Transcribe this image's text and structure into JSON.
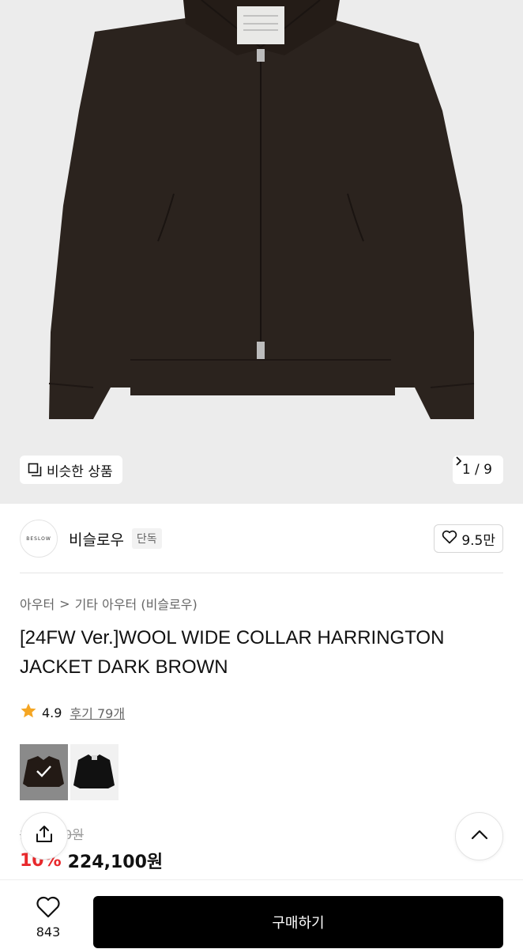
{
  "gallery": {
    "similar_label": "비슷한 상품",
    "counter": "1 / 9",
    "icons": {
      "similar": "similar-products-icon",
      "next": "chevron-right-icon"
    }
  },
  "brand": {
    "logo_text": "BESLOW",
    "name": "비슬로우",
    "tag": "단독",
    "likes": "9.5만"
  },
  "breadcrumb": {
    "first": "아우터",
    "separator": ">",
    "second": "기타 아우터 (비슬로우)"
  },
  "product": {
    "title": "[24FW Ver.]WOOL WIDE COLLAR HARRINGTON JACKET DARK BROWN",
    "rating": "4.9",
    "reviews": "후기 79개",
    "original_price": "249,000원",
    "discount": "10%",
    "price": "224,100원"
  },
  "variants": [
    {
      "name": "dark-brown",
      "selected": true
    },
    {
      "name": "black",
      "selected": false
    }
  ],
  "bottom_bar": {
    "wish_count": "843",
    "buy_label": "구매하기"
  },
  "colors": {
    "accent_red": "#e8292c",
    "star": "#f5a623",
    "buy_button": "#000000",
    "jacket": "#2b231e"
  }
}
